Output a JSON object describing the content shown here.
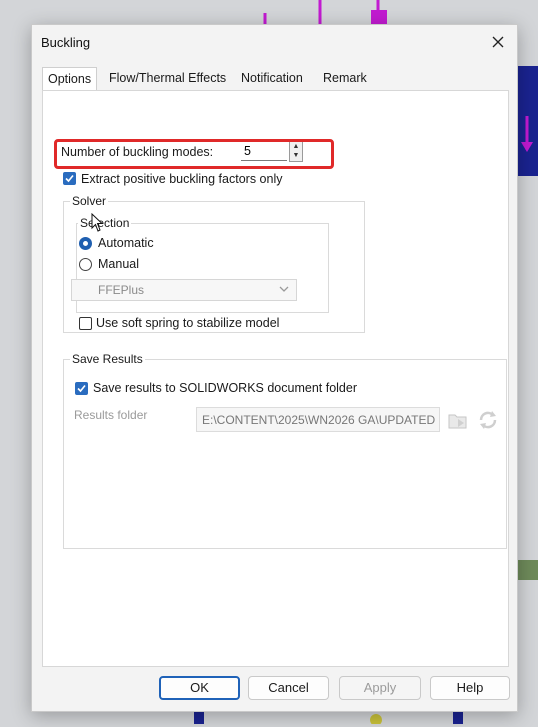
{
  "dialog": {
    "title": "Buckling",
    "close_icon": "close-icon"
  },
  "tabs": [
    {
      "label": "Options",
      "active": true
    },
    {
      "label": "Flow/Thermal Effects",
      "active": false
    },
    {
      "label": "Notification",
      "active": false
    },
    {
      "label": "Remark",
      "active": false
    }
  ],
  "options": {
    "modes_label": "Number of buckling modes:",
    "modes_value": "5",
    "extract_label": "Extract positive buckling factors only",
    "extract_checked": true
  },
  "solver": {
    "legend": "Solver",
    "selection_legend": "Selection",
    "automatic_label": "Automatic",
    "manual_label": "Manual",
    "selected": "Automatic",
    "solver_value": "FFEPlus",
    "soft_spring_label": "Use soft spring to stabilize model",
    "soft_spring_checked": false
  },
  "save_results": {
    "legend": "Save Results",
    "save_label": "Save results to SOLIDWORKS document folder",
    "save_checked": true,
    "results_folder_label": "Results folder",
    "results_folder_value": "E:\\CONTENT\\2025\\WN2026 GA\\UPDATED"
  },
  "buttons": {
    "ok": "OK",
    "cancel": "Cancel",
    "apply": "Apply",
    "help": "Help"
  },
  "colors": {
    "highlight": "#e02929",
    "accent": "#2a6cbf",
    "cad_magenta": "#c21ad1",
    "cad_navy": "#1a2390"
  }
}
